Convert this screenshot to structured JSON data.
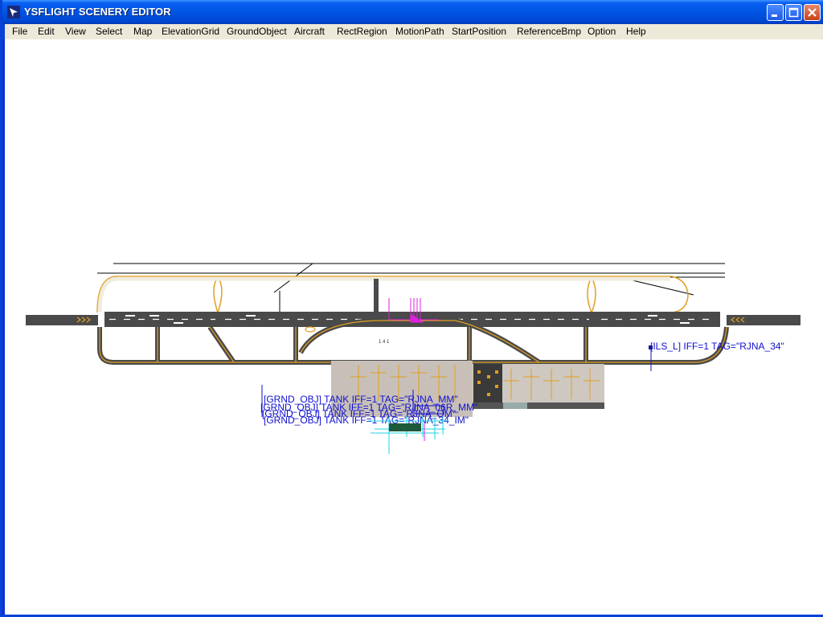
{
  "window": {
    "title": "YSFLIGHT SCENERY EDITOR"
  },
  "menu": [
    {
      "label": "File"
    },
    {
      "label": "Edit"
    },
    {
      "label": "View"
    },
    {
      "label": "Select"
    },
    {
      "label": "Map"
    },
    {
      "label": "ElevationGrid"
    },
    {
      "label": "GroundObject"
    },
    {
      "label": "Aircraft"
    },
    {
      "label": "RectRegion"
    },
    {
      "label": "MotionPath"
    },
    {
      "label": "StartPosition"
    },
    {
      "label": "ReferenceBmp"
    },
    {
      "label": "Option"
    },
    {
      "label": "Help"
    }
  ],
  "scene": {
    "ils_label": "[ILS_L] IFF=1 TAG=\"RJNA_34\"",
    "cluster_labels": [
      "[GRND_OBJ] TANK IFF=1 TAG=\"RJNA_MM\"",
      "[GRND_OBJ] TANK IFF=1 TAG=\"RJNA_06R_MM\"",
      "[GRND_OBJ] TANK IFF=1 TAG=\"RJNA_OM\"",
      "[GRND_OBJ] TANK IFF=1 TAG=\"RJNA_34_IM\""
    ],
    "runway_marking": "1 4 1"
  },
  "colors": {
    "title_bar": "#0054e3",
    "menu_bar": "#ece9d8",
    "canvas": "#ffffff",
    "runway": "#4a4a4a",
    "taxi_line": "#e0a020",
    "apron": "#c8c0b8",
    "label_blue": "#1010d0",
    "path_magenta": "#e020e0",
    "cyan_marker": "#20d0e0"
  }
}
